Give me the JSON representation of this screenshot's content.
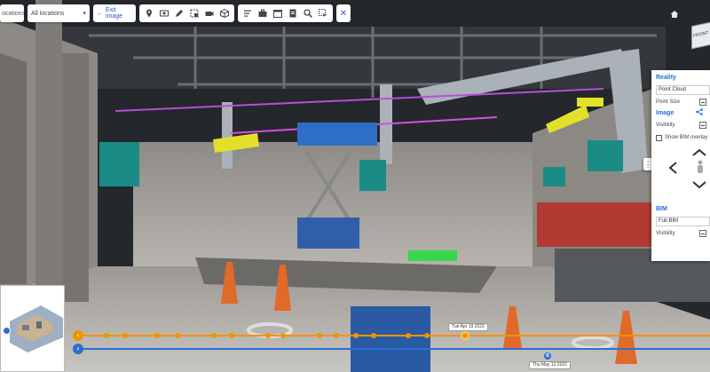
{
  "toolbar": {
    "location_fragment": "ocations",
    "location_select_value": "All locations",
    "exit_image_label": "Exit image",
    "tool_group_1": [
      "pin-icon",
      "capture-icon",
      "pen-icon",
      "crop-icon",
      "camera-icon",
      "cube-icon"
    ],
    "tool_group_2": [
      "list-icon",
      "briefcase-icon",
      "calendar-icon",
      "document-icon",
      "magnifier-icon",
      "select-region-icon"
    ],
    "close_icon": "close-icon"
  },
  "view_cube_label": "FRONT",
  "panel": {
    "reality_title": "Reality",
    "reality_mode_value": "Point Cloud",
    "point_size_label": "Point Size",
    "image_title": "Image",
    "image_visibility_label": "Visibility",
    "show_bim_overlay_label": "Show BIM overlay",
    "show_bim_overlay_checked": false,
    "bim_title": "BIM",
    "bim_mode_value": "Full BIM",
    "bim_visibility_label": "Visibility"
  },
  "timeline": {
    "current_capture_date": "Tue Apr 19 2022",
    "compare_capture_date": "Thu May 12 2022",
    "compare_marker_label": "B"
  },
  "colors": {
    "accent_blue": "#2b6fd6",
    "timeline_orange": "#f39200",
    "panel_title_blue": "#1e6fd9"
  }
}
